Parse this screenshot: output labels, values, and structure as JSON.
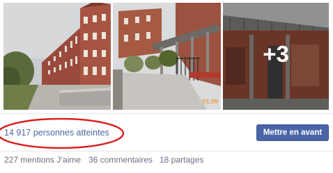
{
  "photos": {
    "items": [
      {
        "alt": "building-photo",
        "stamp": ""
      },
      {
        "alt": "courtyard-photo",
        "stamp": "01.09"
      },
      {
        "alt": "gate-photo",
        "stamp": ""
      }
    ],
    "more_count": "+3"
  },
  "stats": {
    "reach_text": "14 917 personnes atteintes",
    "boost_label": "Mettre en avant"
  },
  "engagement": {
    "likes": "227 mentions J’aime",
    "comments": "36 commentaires",
    "shares": "18 partages"
  },
  "colors": {
    "link_blue": "#4b67a1",
    "button_blue": "#4a64a7",
    "annotation_red": "#d9201e"
  }
}
